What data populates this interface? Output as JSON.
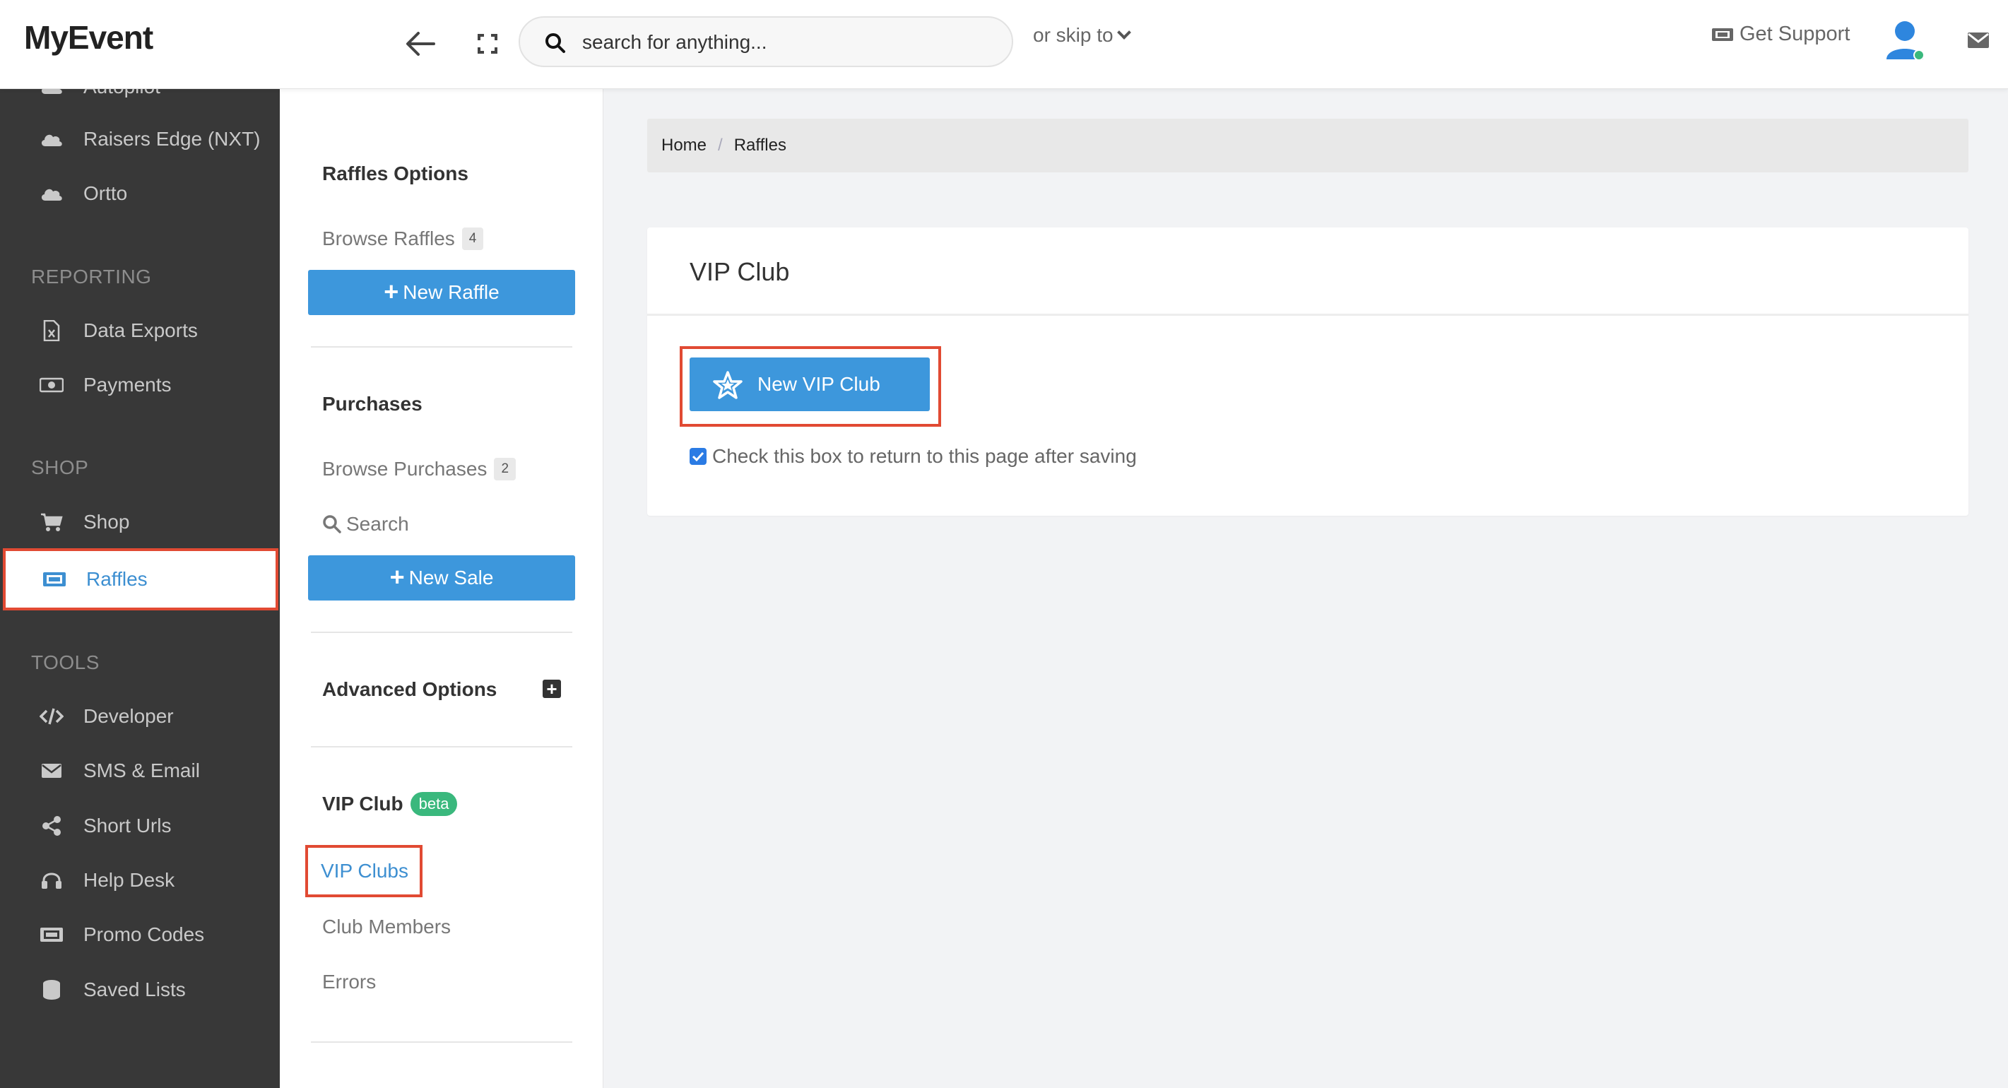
{
  "header": {
    "brand": "MyEvent",
    "search_placeholder": "search for anything...",
    "skip_label": "or skip to",
    "support_label": "Get Support"
  },
  "sidebar": {
    "items_top": [
      {
        "label": "Autopilot",
        "icon": "cloud-icon"
      },
      {
        "label": "Raisers Edge (NXT)",
        "icon": "cloud-icon"
      },
      {
        "label": "Ortto",
        "icon": "cloud-icon"
      }
    ],
    "reporting_heading": "REPORTING",
    "reporting": [
      {
        "label": "Data Exports",
        "icon": "excel-file-icon"
      },
      {
        "label": "Payments",
        "icon": "money-icon"
      }
    ],
    "shop_heading": "SHOP",
    "shop": [
      {
        "label": "Shop",
        "icon": "cart-icon"
      },
      {
        "label": "Raffles",
        "icon": "ticket-icon"
      }
    ],
    "tools_heading": "TOOLS",
    "tools": [
      {
        "label": "Developer",
        "icon": "code-icon"
      },
      {
        "label": "SMS & Email",
        "icon": "envelope-icon"
      },
      {
        "label": "Short Urls",
        "icon": "share-icon"
      },
      {
        "label": "Help Desk",
        "icon": "headset-icon"
      },
      {
        "label": "Promo Codes",
        "icon": "ticket-icon"
      },
      {
        "label": "Saved Lists",
        "icon": "database-icon"
      }
    ]
  },
  "submenu": {
    "raffles_heading": "Raffles Options",
    "browse_raffles": "Browse Raffles",
    "browse_raffles_count": "4",
    "new_raffle": "New Raffle",
    "purchases_heading": "Purchases",
    "browse_purchases": "Browse Purchases",
    "browse_purchases_count": "2",
    "search": "Search",
    "new_sale": "New Sale",
    "advanced_heading": "Advanced Options",
    "vip_heading": "VIP Club",
    "vip_badge": "beta",
    "vip_clubs": "VIP Clubs",
    "club_members": "Club Members",
    "errors": "Errors"
  },
  "breadcrumb": {
    "home": "Home",
    "separator": "/",
    "current": "Raffles"
  },
  "card": {
    "title": "VIP Club",
    "button_label": "New VIP Club",
    "checkbox_label": "Check this box to return to this page after saving",
    "checkbox_checked": true
  },
  "colors": {
    "primary": "#3d97dc",
    "sidebar_bg": "#383838",
    "highlight": "#e14a33",
    "beta": "#3ab87d"
  }
}
